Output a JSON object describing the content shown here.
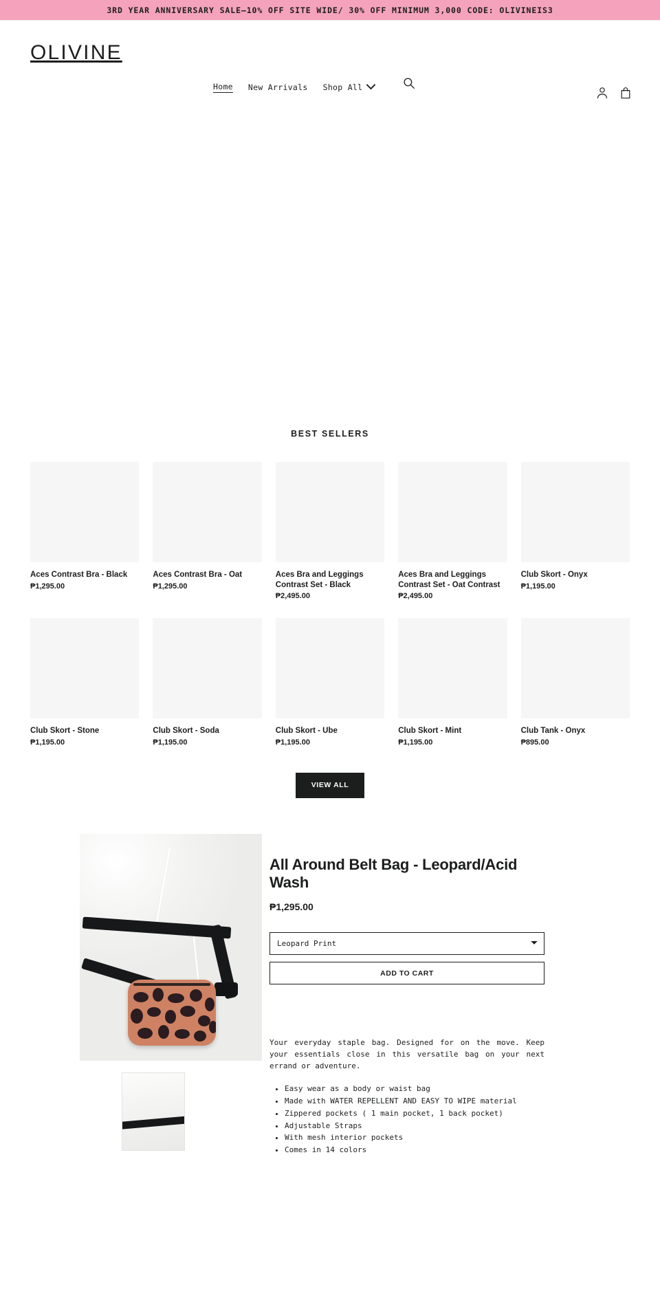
{
  "announcement": {
    "text": "3RD YEAR ANNIVERSARY SALE—10% OFF SITE WIDE/ 30% OFF MINIMUM 3,000 CODE: OLIVINEIS3",
    "background_color": "#f5a3bd"
  },
  "header": {
    "logo": "OLIVINE",
    "nav": [
      {
        "label": "Home",
        "active": true
      },
      {
        "label": "New Arrivals",
        "active": false
      },
      {
        "label": "Shop All",
        "active": false,
        "has_dropdown": true
      }
    ],
    "icons": {
      "search": "search-icon",
      "account": "account-icon",
      "cart": "cart-icon"
    }
  },
  "best_sellers": {
    "title": "BEST SELLERS",
    "products": [
      {
        "title": "Aces Contrast Bra - Black",
        "price": "₱1,295.00"
      },
      {
        "title": "Aces Contrast Bra - Oat",
        "price": "₱1,295.00"
      },
      {
        "title": "Aces Bra and Leggings Contrast Set - Black",
        "price": "₱2,495.00"
      },
      {
        "title": "Aces Bra and Leggings Contrast Set - Oat Contrast",
        "price": "₱2,495.00"
      },
      {
        "title": "Club Skort - Onyx",
        "price": "₱1,195.00"
      },
      {
        "title": "Club Skort - Stone",
        "price": "₱1,195.00"
      },
      {
        "title": "Club Skort - Soda",
        "price": "₱1,195.00"
      },
      {
        "title": "Club Skort - Ube",
        "price": "₱1,195.00"
      },
      {
        "title": "Club Skort - Mint",
        "price": "₱1,195.00"
      },
      {
        "title": "Club Tank - Onyx",
        "price": "₱895.00"
      }
    ],
    "view_all_label": "VIEW ALL"
  },
  "featured_product": {
    "title": "All Around Belt Bag - Leopard/Acid Wash",
    "price": "₱1,295.00",
    "variant_selected": "Leopard Print",
    "variant_options": [
      "Leopard Print"
    ],
    "add_to_cart_label": "ADD TO CART",
    "description": "Your everyday staple bag. Designed for on the move. Keep your essentials close in this versatile bag on your next errand or adventure.",
    "features": [
      "Easy wear as a body or waist bag",
      "Made with WATER REPELLENT AND EASY TO WIPE material",
      "Zippered pockets ( 1 main pocket, 1 back pocket)",
      "Adjustable Straps",
      "With mesh interior pockets",
      "Comes in 14 colors"
    ]
  }
}
